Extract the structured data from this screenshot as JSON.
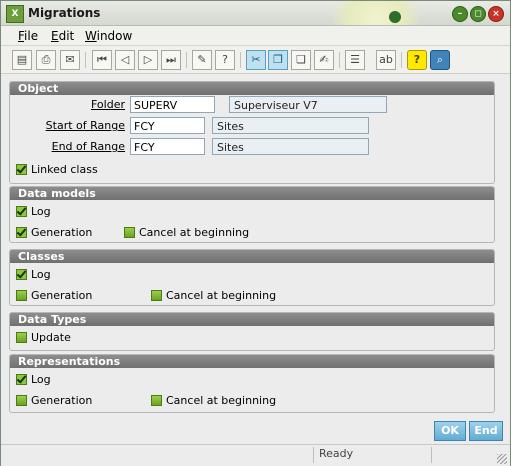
{
  "window": {
    "title": "Migrations",
    "icon": "app-logo-icon",
    "controls": {
      "minimize": "–",
      "maximize": "◻",
      "close": "×"
    }
  },
  "menu": [
    {
      "label_u": "F",
      "label_rest": "ile"
    },
    {
      "label_u": "E",
      "label_rest": "dit"
    },
    {
      "label_u": "W",
      "label_rest": "indow"
    }
  ],
  "toolbar": {
    "icons": [
      "new-icon",
      "print-icon",
      "email-icon",
      "first-icon",
      "previous-icon",
      "next-icon",
      "last-icon",
      "attach-icon",
      "help-block-icon",
      "select-icon",
      "copy-icon",
      "paste-icon",
      "sign-icon",
      "text-report-icon",
      "text-field-icon",
      "help-icon",
      "search-icon"
    ]
  },
  "object": {
    "header": "Object",
    "folder": {
      "label": "Folder",
      "value": "SUPERV",
      "description": "Superviseur V7"
    },
    "start": {
      "label": "Start of Range",
      "value": "FCY",
      "description": "Sites"
    },
    "end": {
      "label": "End of Range",
      "value": "FCY",
      "description": "Sites"
    },
    "linked_class": {
      "label": "Linked class",
      "checked": true
    }
  },
  "data_models": {
    "header": "Data models",
    "log": {
      "label": "Log",
      "checked": true
    },
    "generation": {
      "label": "Generation",
      "checked": true
    },
    "cancel": {
      "label": "Cancel at beginning",
      "checked": false
    }
  },
  "classes": {
    "header": "Classes",
    "log": {
      "label": "Log",
      "checked": true
    },
    "generation": {
      "label": "Generation",
      "checked": false
    },
    "cancel": {
      "label": "Cancel at beginning",
      "checked": false
    }
  },
  "data_types": {
    "header": "Data Types",
    "update": {
      "label": "Update",
      "checked": false
    }
  },
  "representations": {
    "header": "Representations",
    "log": {
      "label": "Log",
      "checked": true
    },
    "generation": {
      "label": "Generation",
      "checked": false
    },
    "cancel": {
      "label": "Cancel at beginning",
      "checked": false
    }
  },
  "buttons": {
    "ok": "OK",
    "end": "End"
  },
  "status": {
    "text": "Ready"
  },
  "colors": {
    "group_header": "#7f7f7f",
    "checkbox_green": "#8ec63f",
    "button_blue": "#62acd4",
    "close_red": "#c8342a"
  }
}
